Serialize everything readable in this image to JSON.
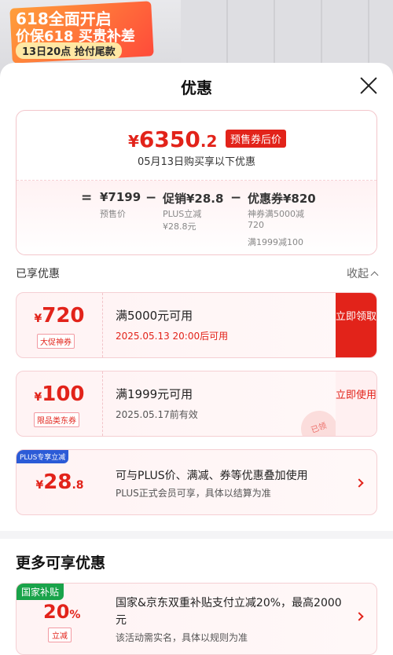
{
  "background": {
    "promo_line1": "618全面开启",
    "promo_line2": "价保618 买贵补差",
    "promo_line3": "13日20点 抢付尾款"
  },
  "sheet": {
    "title": "优惠",
    "close_icon": "close-icon"
  },
  "summary": {
    "currency": "¥",
    "price_int": "6350",
    "price_dec": ".2",
    "price_tag": "预售券后价",
    "purchase_note": "05月13日购买享以下优惠",
    "eq": "=",
    "minus1": "−",
    "minus2": "−",
    "presale_value": "¥7199",
    "presale_label": "预售价",
    "promo_value": "促销¥28.8",
    "promo_sub1": "PLUS立减",
    "promo_sub2": "¥28.8元",
    "coupon_value": "优惠券¥820",
    "coupon_sub1": "神券满5000减",
    "coupon_sub2": "720",
    "coupon_sub3": "满1999减100"
  },
  "enjoyed": {
    "label": "已享优惠",
    "collapse_label": "收起"
  },
  "coupons": [
    {
      "currency": "¥",
      "amount": "720",
      "dec": "",
      "type": "大促神券",
      "condition": "满5000元可用",
      "validity": "2025.05.13 20:00后可用",
      "button": "立即领取"
    },
    {
      "currency": "¥",
      "amount": "100",
      "dec": "",
      "type": "限品类东券",
      "condition": "满1999元可用",
      "validity": "2025.05.17前有效",
      "button": "立即使用",
      "stamp": "已领"
    },
    {
      "badge": "PLUS专享立减",
      "currency": "¥",
      "amount": "28",
      "dec": ".8",
      "desc1": "可与PLUS价、满减、券等优惠叠加使用",
      "desc2": "PLUS正式会员可享，具体以结算为准"
    }
  ],
  "more": {
    "title": "更多可享优惠",
    "subsidy": {
      "badge": "国家补贴",
      "pct": "20",
      "pct_unit": "%",
      "type": "立减",
      "desc1": "国家&京东双重补贴支付立减20%，最高2000元",
      "desc2": "该活动需实名，具体以规则为准"
    }
  },
  "colors": {
    "accent_red": "#e2231a",
    "plus_blue": "#2b5bd7",
    "subsidy_green": "#19a34a"
  }
}
